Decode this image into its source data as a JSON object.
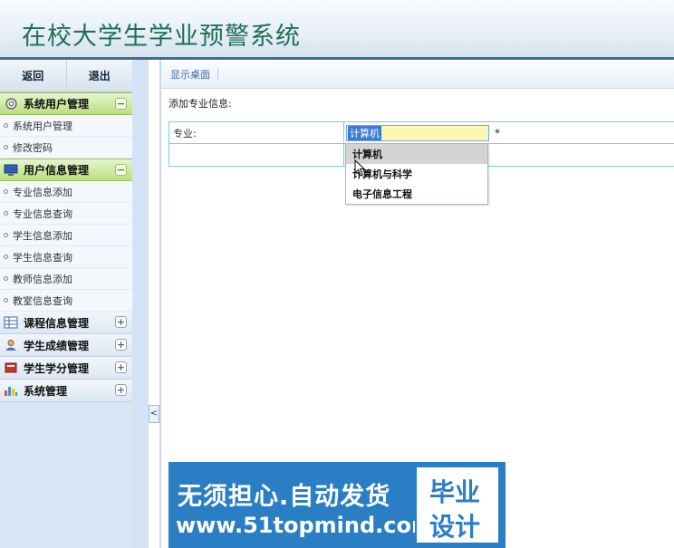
{
  "app": {
    "title": "在校大学生学业预警系统"
  },
  "toolbar": {
    "back_label": "返回",
    "logout_label": "退出"
  },
  "sidebar": {
    "groups": [
      {
        "label": "系统用户管理",
        "state": "open",
        "items": [
          "系统用户管理",
          "修改密码"
        ]
      },
      {
        "label": "用户信息管理",
        "state": "open",
        "items": [
          "专业信息添加",
          "专业信息查询",
          "学生信息添加",
          "学生信息查询",
          "教师信息添加",
          "教室信息查询"
        ]
      },
      {
        "label": "课程信息管理",
        "state": "closed"
      },
      {
        "label": "学生成绩管理",
        "state": "closed"
      },
      {
        "label": "学生学分管理",
        "state": "closed"
      },
      {
        "label": "系统管理",
        "state": "closed"
      }
    ],
    "collapse_glyph": "<"
  },
  "tabs": {
    "active": "显示桌面"
  },
  "form": {
    "section_title": "添加专业信息:",
    "field_label": "专业:",
    "field_value": "计算机",
    "required_mark": "*"
  },
  "dropdown": {
    "options": [
      "计算机",
      "计算机与科学",
      "电子信息工程"
    ],
    "highlighted_index": 0
  },
  "banner": {
    "slogan": "无须担心.自动发货",
    "url": "www.51topmind.com",
    "badge_line1": "毕业",
    "badge_line2": "设计"
  },
  "colors": {
    "header_text": "#1f6f57",
    "group_open": "#b9df7e",
    "form_border": "#6ad4dc",
    "banner_bg": "#2a7ec4"
  }
}
